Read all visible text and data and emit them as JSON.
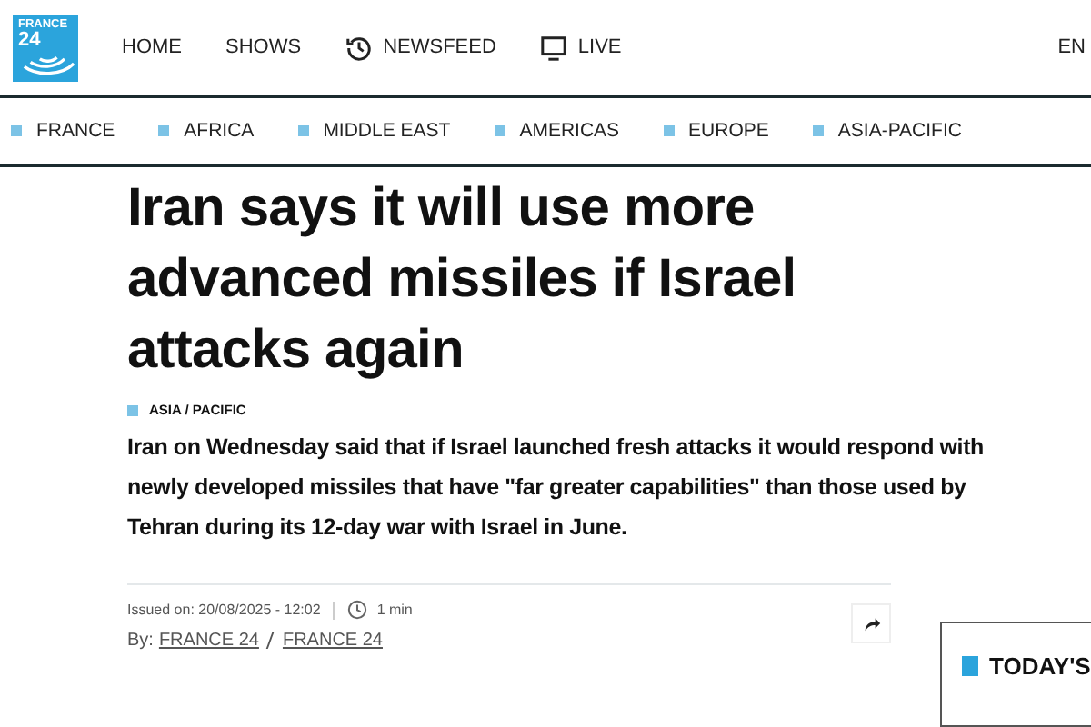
{
  "logo": {
    "line_1": "FRANCE",
    "line_2": "24"
  },
  "main_nav": [
    {
      "label": "HOME"
    },
    {
      "label": "SHOWS"
    },
    {
      "label": "NEWSFEED"
    },
    {
      "label": "LIVE"
    }
  ],
  "language": "EN",
  "categories": [
    "FRANCE",
    "AFRICA",
    "MIDDLE EAST",
    "AMERICAS",
    "EUROPE",
    "ASIA-PACIFIC"
  ],
  "article": {
    "headline": "Iran says it will use more advanced missiles if Israel attacks again",
    "section": "ASIA / PACIFIC",
    "lead": "Iran on Wednesday said that if Israel launched fresh attacks it would respond with newly developed missiles that have \"far greater capabilities\" than those used by Tehran during its 12-day war with Israel in June.",
    "issued": "Issued on: 20/08/2025 - 12:02",
    "read_time": "1 min",
    "by_label": "By:",
    "authors": [
      "FRANCE 24",
      "FRANCE 24"
    ]
  },
  "sidebar": {
    "title": "TODAY'S"
  }
}
